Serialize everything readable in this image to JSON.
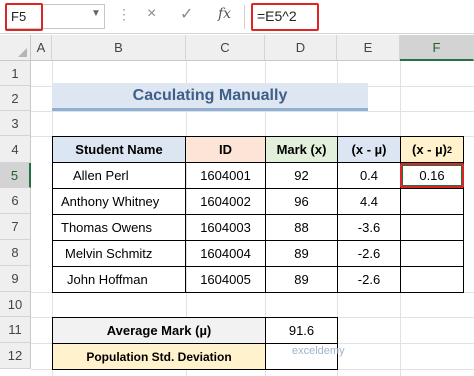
{
  "formula_bar": {
    "name_box": "F5",
    "formula": "=E5^2",
    "cancel_icon": "×",
    "enter_icon": "✓",
    "fx_label": "fx",
    "dots": "⋮"
  },
  "columns": [
    "A",
    "B",
    "C",
    "D",
    "E",
    "F"
  ],
  "rows": [
    "1",
    "2",
    "3",
    "4",
    "5",
    "6",
    "7",
    "8",
    "9",
    "10",
    "11",
    "12"
  ],
  "sheet": {
    "title": "Caculating Manually",
    "headers": {
      "student": "Student Name",
      "id": "ID",
      "mark": "Mark (x)",
      "dev": "(x - µ)",
      "sq": "(x - µ)",
      "sq_sup": "2"
    },
    "data": [
      {
        "name": "Allen Perl",
        "id": "1604001",
        "mark": "92",
        "dev": "0.4",
        "sq": "0.16"
      },
      {
        "name": "Anthony Whitney",
        "id": "1604002",
        "mark": "96",
        "dev": "4.4",
        "sq": ""
      },
      {
        "name": "Thomas Owens",
        "id": "1604003",
        "mark": "88",
        "dev": "-3.6",
        "sq": ""
      },
      {
        "name": "Melvin Schmitz",
        "id": "1604004",
        "mark": "89",
        "dev": "-2.6",
        "sq": ""
      },
      {
        "name": "John Hoffman",
        "id": "1604005",
        "mark": "89",
        "dev": "-2.6",
        "sq": ""
      }
    ],
    "avg_label": "Average Mark (µ)",
    "avg_value": "91.6",
    "pop_label": "Population Std. Deviation",
    "pop_value": ""
  },
  "watermark": "exceldemy",
  "colors": {
    "highlight_red": "#e02424",
    "excel_green": "#217346"
  }
}
